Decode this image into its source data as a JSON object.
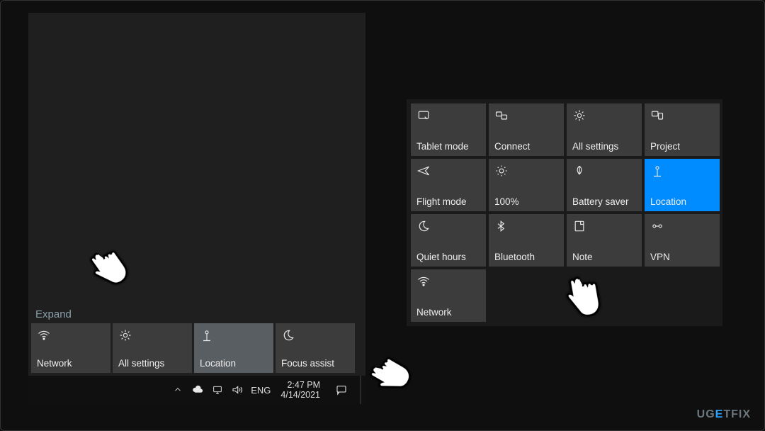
{
  "left": {
    "expand_label": "Expand",
    "tiles": [
      {
        "label": "Network",
        "icon": "wifi-icon",
        "selected": false
      },
      {
        "label": "All settings",
        "icon": "gear-icon",
        "selected": false
      },
      {
        "label": "Location",
        "icon": "location-icon",
        "selected": true
      },
      {
        "label": "Focus assist",
        "icon": "moon-icon",
        "selected": false
      }
    ],
    "taskbar": {
      "lang": "ENG",
      "time": "2:47 PM",
      "date": "4/14/2021"
    }
  },
  "right": {
    "tiles": [
      {
        "label": "Tablet mode",
        "icon": "tablet-icon",
        "active": false
      },
      {
        "label": "Connect",
        "icon": "connect-icon",
        "active": false
      },
      {
        "label": "All settings",
        "icon": "gear-icon",
        "active": false
      },
      {
        "label": "Project",
        "icon": "project-icon",
        "active": false
      },
      {
        "label": "Flight mode",
        "icon": "airplane-icon",
        "active": false
      },
      {
        "label": "100%",
        "icon": "brightness-icon",
        "active": false
      },
      {
        "label": "Battery saver",
        "icon": "leaf-icon",
        "active": false
      },
      {
        "label": "Location",
        "icon": "location-icon",
        "active": true
      },
      {
        "label": "Quiet hours",
        "icon": "moon-icon",
        "active": false
      },
      {
        "label": "Bluetooth",
        "icon": "bluetooth-icon",
        "active": false
      },
      {
        "label": "Note",
        "icon": "note-icon",
        "active": false
      },
      {
        "label": "VPN",
        "icon": "vpn-icon",
        "active": false
      },
      {
        "label": "Network",
        "icon": "wifi-icon",
        "active": false
      }
    ]
  },
  "watermark": {
    "pre": "UG",
    "accent": "E",
    "post": "TFIX"
  }
}
